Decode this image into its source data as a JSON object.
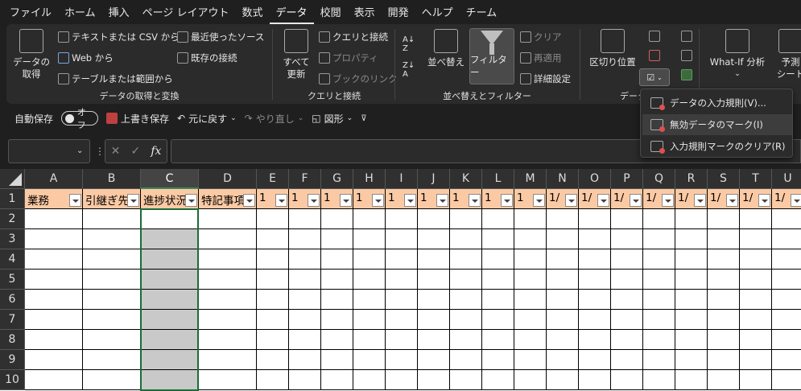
{
  "tabs": [
    {
      "label": "ファイル",
      "active": false
    },
    {
      "label": "ホーム",
      "active": false
    },
    {
      "label": "挿入",
      "active": false
    },
    {
      "label": "ページ レイアウト",
      "active": false
    },
    {
      "label": "数式",
      "active": false
    },
    {
      "label": "データ",
      "active": true
    },
    {
      "label": "校閲",
      "active": false
    },
    {
      "label": "表示",
      "active": false
    },
    {
      "label": "開発",
      "active": false
    },
    {
      "label": "ヘルプ",
      "active": false
    },
    {
      "label": "チーム",
      "active": false
    }
  ],
  "ribbon": {
    "get_data": {
      "label": "データの\n取得",
      "text_csv": "テキストまたは CSV から",
      "web": "Web から",
      "table_range": "テーブルまたは範囲から",
      "recent_sources": "最近使ったソース",
      "existing_connections": "既存の接続",
      "group_label": "データの取得と変換"
    },
    "queries": {
      "refresh_all": "すべて\n更新",
      "queries_connections": "クエリと接続",
      "properties": "プロパティ",
      "edit_links": "ブックのリンク",
      "group_label": "クエリと接続"
    },
    "sort_filter": {
      "sort": "並べ替え",
      "filter": "フィルター",
      "clear": "クリア",
      "reapply": "再適用",
      "advanced": "詳細設定",
      "group_label": "並べ替えとフィルター"
    },
    "data_tools": {
      "text_to_columns": "区切り位置",
      "group_label": "データ"
    },
    "forecast": {
      "what_if": "What-If 分析",
      "forecast_sheet": "予測\nシート"
    }
  },
  "qat": {
    "autosave": "自動保存",
    "autosave_state": "オフ",
    "save": "上書き保存",
    "undo": "元に戻す",
    "redo": "やり直し",
    "shapes": "図形"
  },
  "formula_bar": {
    "name_box": "",
    "cancel": "✕",
    "enter": "✓",
    "fx": "fx",
    "content": ""
  },
  "columns": [
    "A",
    "B",
    "C",
    "D",
    "E",
    "F",
    "G",
    "H",
    "I",
    "J",
    "K",
    "L",
    "M",
    "N",
    "O",
    "P",
    "Q",
    "R",
    "S",
    "T",
    "U"
  ],
  "rows": [
    "1",
    "2",
    "3",
    "4",
    "5",
    "6",
    "7",
    "8",
    "9",
    "10"
  ],
  "header_row": [
    "業務",
    "引継ぎ先",
    "進捗状況",
    "特記事項",
    "1",
    "1",
    "1",
    "1",
    "1",
    "1",
    "1",
    "1",
    "1",
    "1/",
    "1/",
    "1/",
    "1/",
    "1/",
    "1/",
    "1/",
    "1/"
  ],
  "menu": {
    "items": [
      {
        "label": "データの入力規則(V)...",
        "icon": "data-validation-icon"
      },
      {
        "label": "無効データのマーク(I)",
        "icon": "circle-invalid-icon"
      },
      {
        "label": "入力規則マークのクリア(R)",
        "icon": "clear-circles-icon"
      }
    ]
  },
  "colors": {
    "header_fill": "#fbcaa4",
    "selected_column_fill": "#c9c9c9",
    "active_border": "#1d6b3a"
  }
}
